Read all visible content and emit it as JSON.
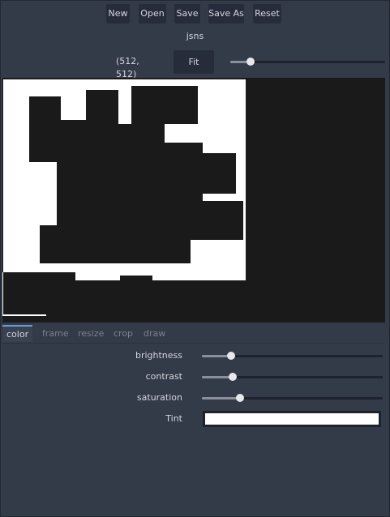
{
  "toolbar": {
    "new_label": "New",
    "open_label": "Open",
    "save_label": "Save",
    "save_as_label": "Save As",
    "reset_label": "Reset"
  },
  "file_name": "jsns",
  "view": {
    "size_readout": "(512, 512)",
    "fit_label": "Fit",
    "zoom_fraction": 0.13
  },
  "tabs": [
    "color",
    "frame",
    "resize",
    "crop",
    "draw"
  ],
  "active_tab": "color",
  "color_panel": {
    "brightness": {
      "label": "brightness",
      "fraction": 0.16
    },
    "contrast": {
      "label": "contrast",
      "fraction": 0.17
    },
    "saturation": {
      "label": "saturation",
      "fraction": 0.21
    },
    "tint": {
      "label": "Tint",
      "color": "#ffffff"
    }
  },
  "colors": {
    "background": "#333a48",
    "button": "#262c3a",
    "accent": "#6a9ad8",
    "canvas_background": "#1a1a1a",
    "image_white": "#ffffff",
    "image_black": "#1a1a1a"
  }
}
